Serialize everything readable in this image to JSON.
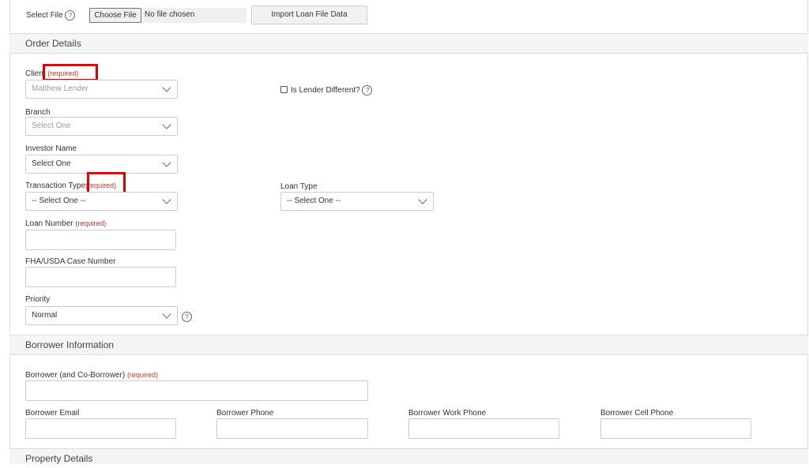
{
  "file_row": {
    "select_file_label": "Select File",
    "help_glyph": "?",
    "choose_file_label": "Choose File",
    "no_file_text": "No file chosen",
    "import_button": "Import Loan File Data"
  },
  "order_details": {
    "title": "Order Details",
    "client_label": "Client",
    "client_required": "(required)",
    "client_value": "Matthew Lender",
    "lender_diff_label": "Is Lender Different?",
    "branch_label": "Branch",
    "branch_value": "Select One",
    "investor_label": "Investor Name",
    "investor_value": "Select One",
    "transaction_label": "Transaction Type",
    "transaction_required": "(required)",
    "transaction_value": "-- Select One --",
    "loan_type_label": "Loan Type",
    "loan_type_value": "-- Select One --",
    "loan_number_label": "Loan Number",
    "loan_number_required": "(required)",
    "fha_label": "FHA/USDA Case Number",
    "priority_label": "Priority",
    "priority_value": "Normal"
  },
  "borrower_info": {
    "title": "Borrower Information",
    "borrower_label": "Borrower (and Co-Borrower)",
    "borrower_required": "(required)",
    "email_label": "Borrower Email",
    "phone_label": "Borrower Phone",
    "work_phone_label": "Borrower Work Phone",
    "cell_phone_label": "Borrower Cell Phone"
  },
  "property_details": {
    "title": "Property Details"
  },
  "colors": {
    "required": "#c0392b",
    "highlight": "#e00000",
    "section_bg": "#f5f5f5"
  }
}
